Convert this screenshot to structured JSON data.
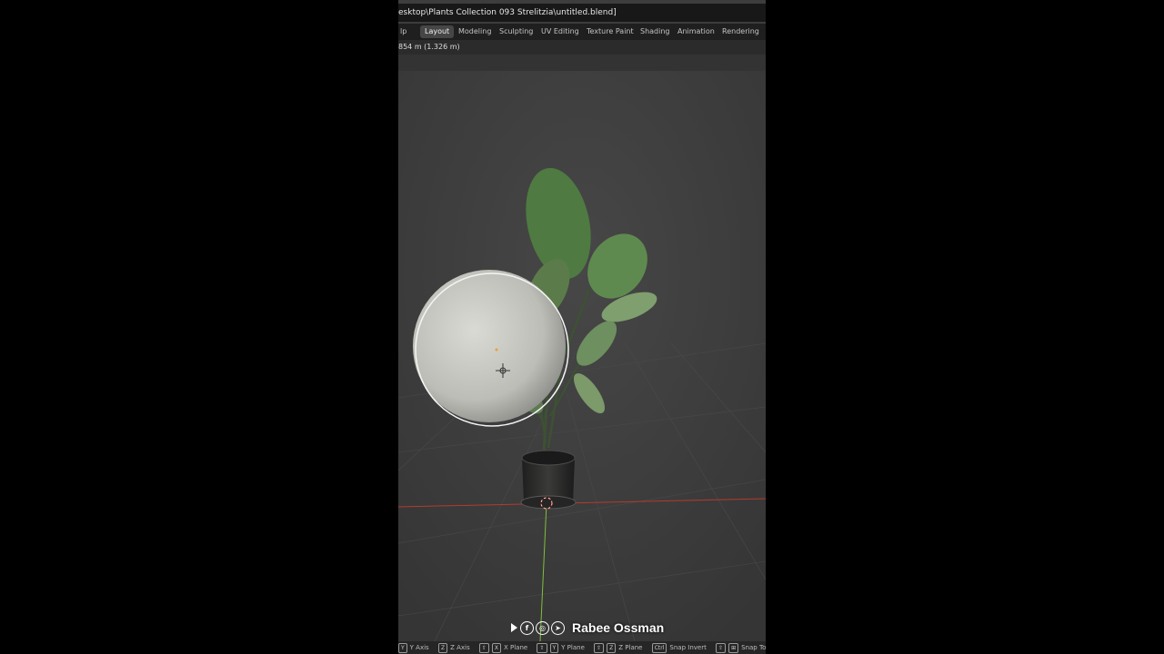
{
  "window": {
    "title": "esktop\\Plants Collection 093 Strelitzia\\untitled.blend]"
  },
  "workspaces": [
    {
      "label": "lp",
      "active": false
    },
    {
      "label": "Layout",
      "active": true
    },
    {
      "label": "Modeling",
      "active": false
    },
    {
      "label": "Sculpting",
      "active": false
    },
    {
      "label": "UV Editing",
      "active": false
    },
    {
      "label": "Texture Paint",
      "active": false
    },
    {
      "label": "Shading",
      "active": false
    },
    {
      "label": "Animation",
      "active": false
    },
    {
      "label": "Rendering",
      "active": false
    }
  ],
  "viewport": {
    "measure_text": "854 m (1.326 m)",
    "colors": {
      "background": "#3d3d3d",
      "x_axis": "#c0392b",
      "y_axis": "#7fbf3f",
      "leaf": "#4f7a42",
      "pot": "#2a2a2a"
    }
  },
  "statusbar": {
    "hints": [
      {
        "keys": [
          "Y"
        ],
        "label": "Y Axis"
      },
      {
        "keys": [
          "Z"
        ],
        "label": "Z Axis"
      },
      {
        "keys": [
          "⇧",
          "X"
        ],
        "label": "X Plane"
      },
      {
        "keys": [
          "⇧",
          "Y"
        ],
        "label": "Y Plane"
      },
      {
        "keys": [
          "⇧",
          "Z"
        ],
        "label": "Z Plane"
      },
      {
        "keys": [
          "Ctrl"
        ],
        "label": "Snap Invert"
      },
      {
        "keys": [
          "⇧",
          "⊞"
        ],
        "label": "Snap Tog"
      }
    ]
  },
  "watermark": {
    "name": "Rabee Ossman",
    "icons": [
      "play-icon",
      "facebook-icon",
      "instagram-icon",
      "telegram-icon"
    ]
  }
}
